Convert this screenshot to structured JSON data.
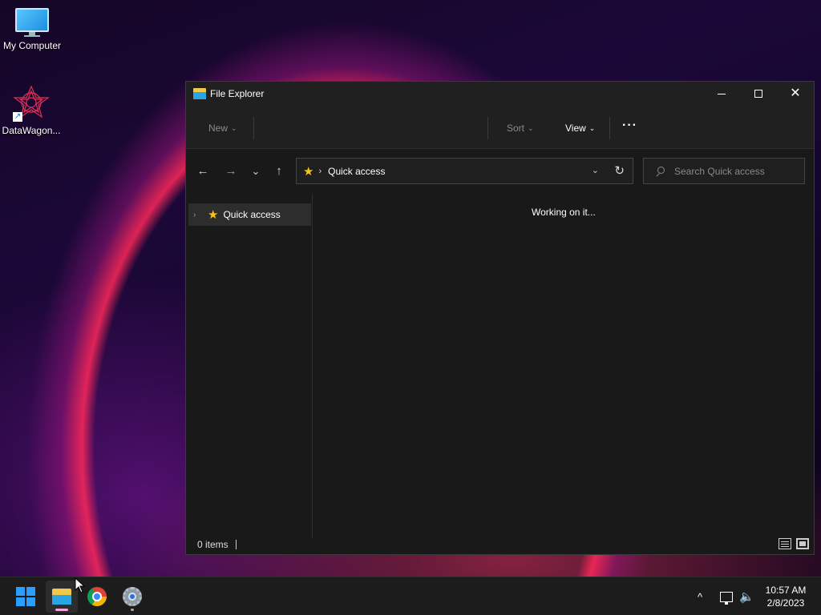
{
  "desktop": {
    "icons": [
      {
        "label": "My Computer",
        "icon": "monitor-icon"
      },
      {
        "label": "DataWagon...",
        "icon": "datawagon-logo-icon"
      }
    ]
  },
  "window": {
    "title": "File Explorer",
    "controls": {
      "minimize": "minimize-icon",
      "maximize": "maximize-icon",
      "close": "✕"
    },
    "commandbar": {
      "new_label": "New",
      "sort_label": "Sort",
      "view_label": "View",
      "more_label": "···"
    },
    "nav": {
      "back": "←",
      "forward": "→",
      "recent": "⌄",
      "up": "↑"
    },
    "address": {
      "location": "Quick access",
      "separator": "›"
    },
    "search": {
      "placeholder": "Search Quick access",
      "value": ""
    },
    "navpane": {
      "items": [
        {
          "label": "Quick access",
          "expand": "›"
        }
      ]
    },
    "content": {
      "message": "Working on it..."
    },
    "status": {
      "item_count": "0 items"
    }
  },
  "taskbar": {
    "apps": [
      "start-icon",
      "file-explorer-icon",
      "chrome-icon",
      "settings-icon"
    ],
    "tray": {
      "chevron": "^",
      "volume": "🔈"
    },
    "clock": {
      "time": "10:57 AM",
      "date": "2/8/2023"
    }
  },
  "colors": {
    "accent_blue": "#2b9fff",
    "star_yellow": "#f5c518",
    "window_bg": "#191919"
  }
}
